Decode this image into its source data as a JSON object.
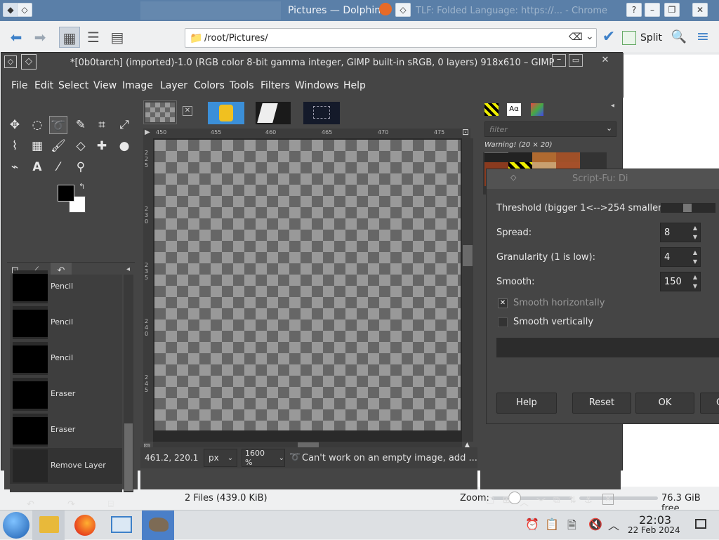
{
  "dolphin": {
    "title": "Pictures — Dolphin",
    "bg_tab_title": "TLF: Folded Language: https://... - Chrome",
    "path": "/root/Pictures/",
    "split_label": "Split",
    "status_files": "2 Files (439.0 KiB)",
    "zoom_label": "Zoom:",
    "free_space": "76.3 GiB free"
  },
  "gimp": {
    "title": "*[0b0tarch] (imported)-1.0 (RGB color 8-bit gamma integer, GIMP built-in sRGB, 0 layers) 918x610 – GIMP",
    "menus": [
      "File",
      "Edit",
      "Select",
      "View",
      "Image",
      "Layer",
      "Colors",
      "Tools",
      "Filters",
      "Windows",
      "Help"
    ],
    "history": [
      "Pencil",
      "Pencil",
      "Pencil",
      "Eraser",
      "Eraser",
      "Remove Layer"
    ],
    "ruler_ticks": [
      "450",
      "455",
      "460",
      "465",
      "470",
      "475"
    ],
    "vruler_ticks": [
      "225",
      "230",
      "235",
      "240",
      "245"
    ],
    "coords": "461.2, 220.1",
    "unit": "px",
    "zoom": "1600 %",
    "status_msg": "Can't work on an empty image, add ...",
    "brush_filter_placeholder": "filter",
    "brush_warning": "Warning! (20 × 20)"
  },
  "scriptfu": {
    "title": "Script-Fu: Di",
    "threshold_label": "Threshold (bigger 1<-->254 smaller):",
    "spread_label": "Spread:",
    "spread_value": "8",
    "granularity_label": "Granularity (1 is low):",
    "granularity_value": "4",
    "smooth_label": "Smooth:",
    "smooth_value": "150",
    "smooth_h_label": "Smooth horizontally",
    "smooth_v_label": "Smooth vertically",
    "help_label": "Help",
    "reset_label": "Reset",
    "ok_label": "OK",
    "cancel_label": "C"
  },
  "taskbar": {
    "time": "22:03",
    "date": "22 Feb 2024"
  },
  "colors": {
    "gimp_bg": "#454545",
    "dolphin_title": "#5a7fa8",
    "accent": "#3d80c8"
  }
}
